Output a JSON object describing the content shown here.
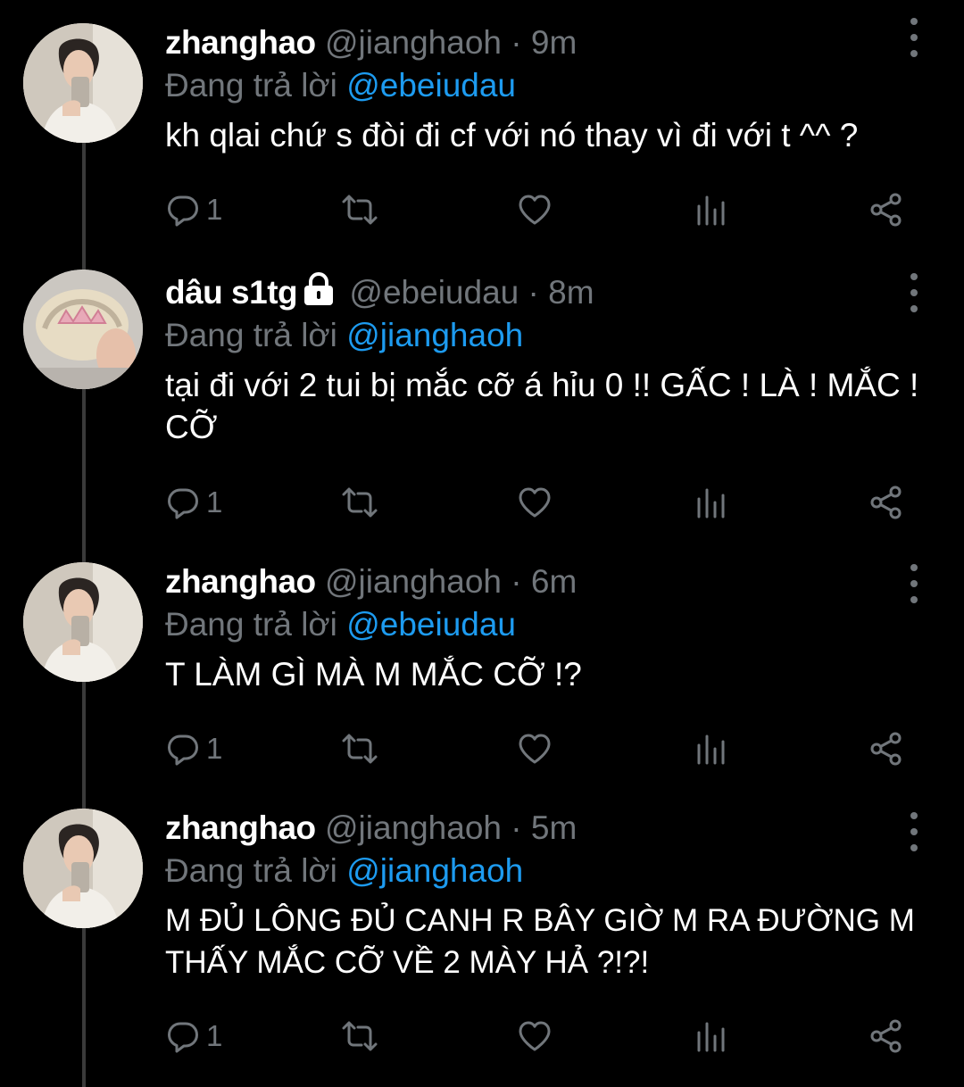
{
  "colors": {
    "background": "#000000",
    "muted": "#71767b",
    "accent": "#1d9bf0",
    "text": "#ffffff"
  },
  "tweets": [
    {
      "name": "zhanghao",
      "handle": "@jianghaoh",
      "time": "9m",
      "locked": false,
      "replying_prefix": "Đang trả lời",
      "replying_to": "@ebeiudau",
      "text": "kh qlai chứ s đòi đi cf với nó thay vì đi với t ^^ ?",
      "reply_count": "1",
      "avatar": "avatar-zhanghao"
    },
    {
      "name": "dâu s1tg",
      "handle": "@ebeiudau",
      "time": "8m",
      "locked": true,
      "replying_prefix": "Đang trả lời",
      "replying_to": "@jianghaoh",
      "text": "tại đi với 2 tui bị mắc cỡ á hỉu 0 !! GẤC ! LÀ ! MẮC ! CỠ",
      "reply_count": "1",
      "avatar": "avatar-dau"
    },
    {
      "name": "zhanghao",
      "handle": "@jianghaoh",
      "time": "6m",
      "locked": false,
      "replying_prefix": "Đang trả lời",
      "replying_to": "@ebeiudau",
      "text": "T LÀM GÌ MÀ M MẮC CỠ !?",
      "reply_count": "1",
      "avatar": "avatar-zhanghao"
    },
    {
      "name": "zhanghao",
      "handle": "@jianghaoh",
      "time": "5m",
      "locked": false,
      "replying_prefix": "Đang trả lời",
      "replying_to": "@jianghaoh",
      "text": "M ĐỦ LÔNG ĐỦ CANH R BÂY GIỜ M RA ĐƯỜNG M THẤY MẮC CỠ VỀ 2 MÀY HẢ ?!?!",
      "reply_count": "1",
      "avatar": "avatar-zhanghao"
    }
  ],
  "separator": "·"
}
